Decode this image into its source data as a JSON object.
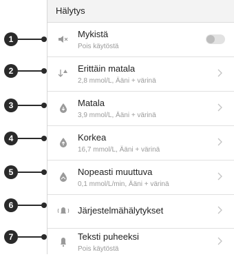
{
  "header": {
    "title": "Hälytys"
  },
  "rows": [
    {
      "title": "Mykistä",
      "subtitle": "Pois käytöstä",
      "icon": "mute-icon",
      "control": "toggle",
      "toggle_on": false
    },
    {
      "title": "Erittäin matala",
      "subtitle": "2,8 mmol/L, Ääni + värinä",
      "icon": "very-low-icon",
      "control": "chevron"
    },
    {
      "title": "Matala",
      "subtitle": "3,9 mmol/L, Ääni + värinä",
      "icon": "low-drop-icon",
      "control": "chevron"
    },
    {
      "title": "Korkea",
      "subtitle": "16,7 mmol/L, Ääni + värinä",
      "icon": "high-drop-icon",
      "control": "chevron"
    },
    {
      "title": "Nopeasti muuttuva",
      "subtitle": "0,1 mmol/L/min, Ääni + värinä",
      "icon": "rapid-change-icon",
      "control": "chevron"
    },
    {
      "title": "Järjestelmähälytykset",
      "subtitle": "",
      "icon": "system-alert-icon",
      "control": "chevron"
    },
    {
      "title": "Teksti puheeksi",
      "subtitle": "Pois käytöstä",
      "icon": "text-to-speech-icon",
      "control": "chevron"
    }
  ],
  "callouts": [
    "1",
    "2",
    "3",
    "4",
    "5",
    "6",
    "7"
  ],
  "colors": {
    "header_bg": "#f3f3f3",
    "callout": "#2a2a2a",
    "icon_gray": "#9a9a9a"
  }
}
